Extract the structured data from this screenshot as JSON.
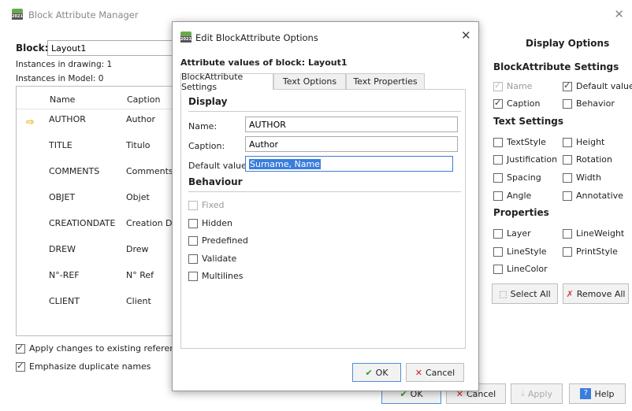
{
  "app": {
    "title": "Block Attribute Manager"
  },
  "main": {
    "block_label": "Block:",
    "block_value": "Layout1",
    "instances_drawing": "Instances in drawing: 1",
    "instances_model": "Instances in Model: 0",
    "table": {
      "headers": [
        "Name",
        "Caption"
      ],
      "rows": [
        {
          "name": "AUTHOR",
          "caption": "Author",
          "current": true
        },
        {
          "name": "TITLE",
          "caption": "Titulo"
        },
        {
          "name": "COMMENTS",
          "caption": "Comments"
        },
        {
          "name": "OBJET",
          "caption": "Objet"
        },
        {
          "name": "CREATIONDATE",
          "caption": "Creation D"
        },
        {
          "name": "DREW",
          "caption": "Drew"
        },
        {
          "name": "N°-REF",
          "caption": "N° Ref"
        },
        {
          "name": "CLIENT",
          "caption": "Client"
        }
      ]
    },
    "apply_changes": "Apply changes to existing references",
    "emphasize": "Emphasize duplicate names"
  },
  "display_options": {
    "title": "Display Options",
    "block_settings_title": "BlockAttribute Settings",
    "name": "Name",
    "default_value": "Default value",
    "caption": "Caption",
    "behavior": "Behavior",
    "text_settings_title": "Text Settings",
    "textstyle": "TextStyle",
    "height": "Height",
    "justification": "Justification",
    "rotation": "Rotation",
    "spacing": "Spacing",
    "width": "Width",
    "angle": "Angle",
    "annotative": "Annotative",
    "properties_title": "Properties",
    "layer": "Layer",
    "lineweight": "LineWeight",
    "linestyle": "LineStyle",
    "printstyle": "PrintStyle",
    "linecolor": "LineColor",
    "select_all": "Select All",
    "remove_all": "Remove All"
  },
  "bottom_buttons": {
    "ok": "OK",
    "cancel": "Cancel",
    "apply": "Apply",
    "help": "Help"
  },
  "dialog": {
    "title": "Edit BlockAttribute Options",
    "subtitle": "Attribute values of block: Layout1",
    "tabs": [
      "BlockAttribute Settings",
      "Text Options",
      "Text Properties"
    ],
    "display_section": "Display",
    "name_label": "Name:",
    "name_value": "AUTHOR",
    "caption_label": "Caption:",
    "caption_value": "Author",
    "default_label": "Default value:",
    "default_value": "Surname, Name",
    "behaviour_section": "Behaviour",
    "fixed": "Fixed",
    "hidden": "Hidden",
    "predefined": "Predefined",
    "validate": "Validate",
    "multilines": "Multilines",
    "ok": "OK",
    "cancel": "Cancel"
  }
}
